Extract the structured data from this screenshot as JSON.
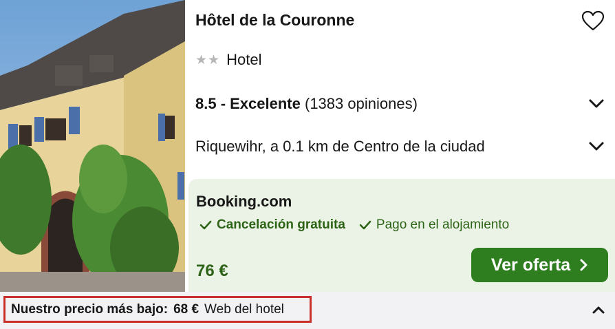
{
  "hotel": {
    "name": "Hôtel de la Couronne",
    "star_count": 2,
    "type": "Hotel",
    "rating_score": "8.5 - Excelente",
    "rating_count": "(1383 opiniones)",
    "location": "Riquewihr, a 0.1 km de Centro de la ciudad"
  },
  "deal": {
    "provider": "Booking.com",
    "features": [
      "Cancelación gratuita",
      "Pago en el alojamiento"
    ],
    "price": "76 €",
    "cta_label": "Ver oferta"
  },
  "lowest_price": {
    "label": "Nuestro precio más bajo:",
    "price": "68 €",
    "source": "Web del hotel"
  },
  "colors": {
    "accent_green": "#2e7d1f",
    "deal_bg": "#ebf3e6",
    "highlight_border": "#c8302b"
  },
  "icons": [
    "heart-icon",
    "star-icon",
    "chevron-down-icon",
    "check-icon",
    "chevron-right-icon",
    "chevron-up-icon"
  ]
}
